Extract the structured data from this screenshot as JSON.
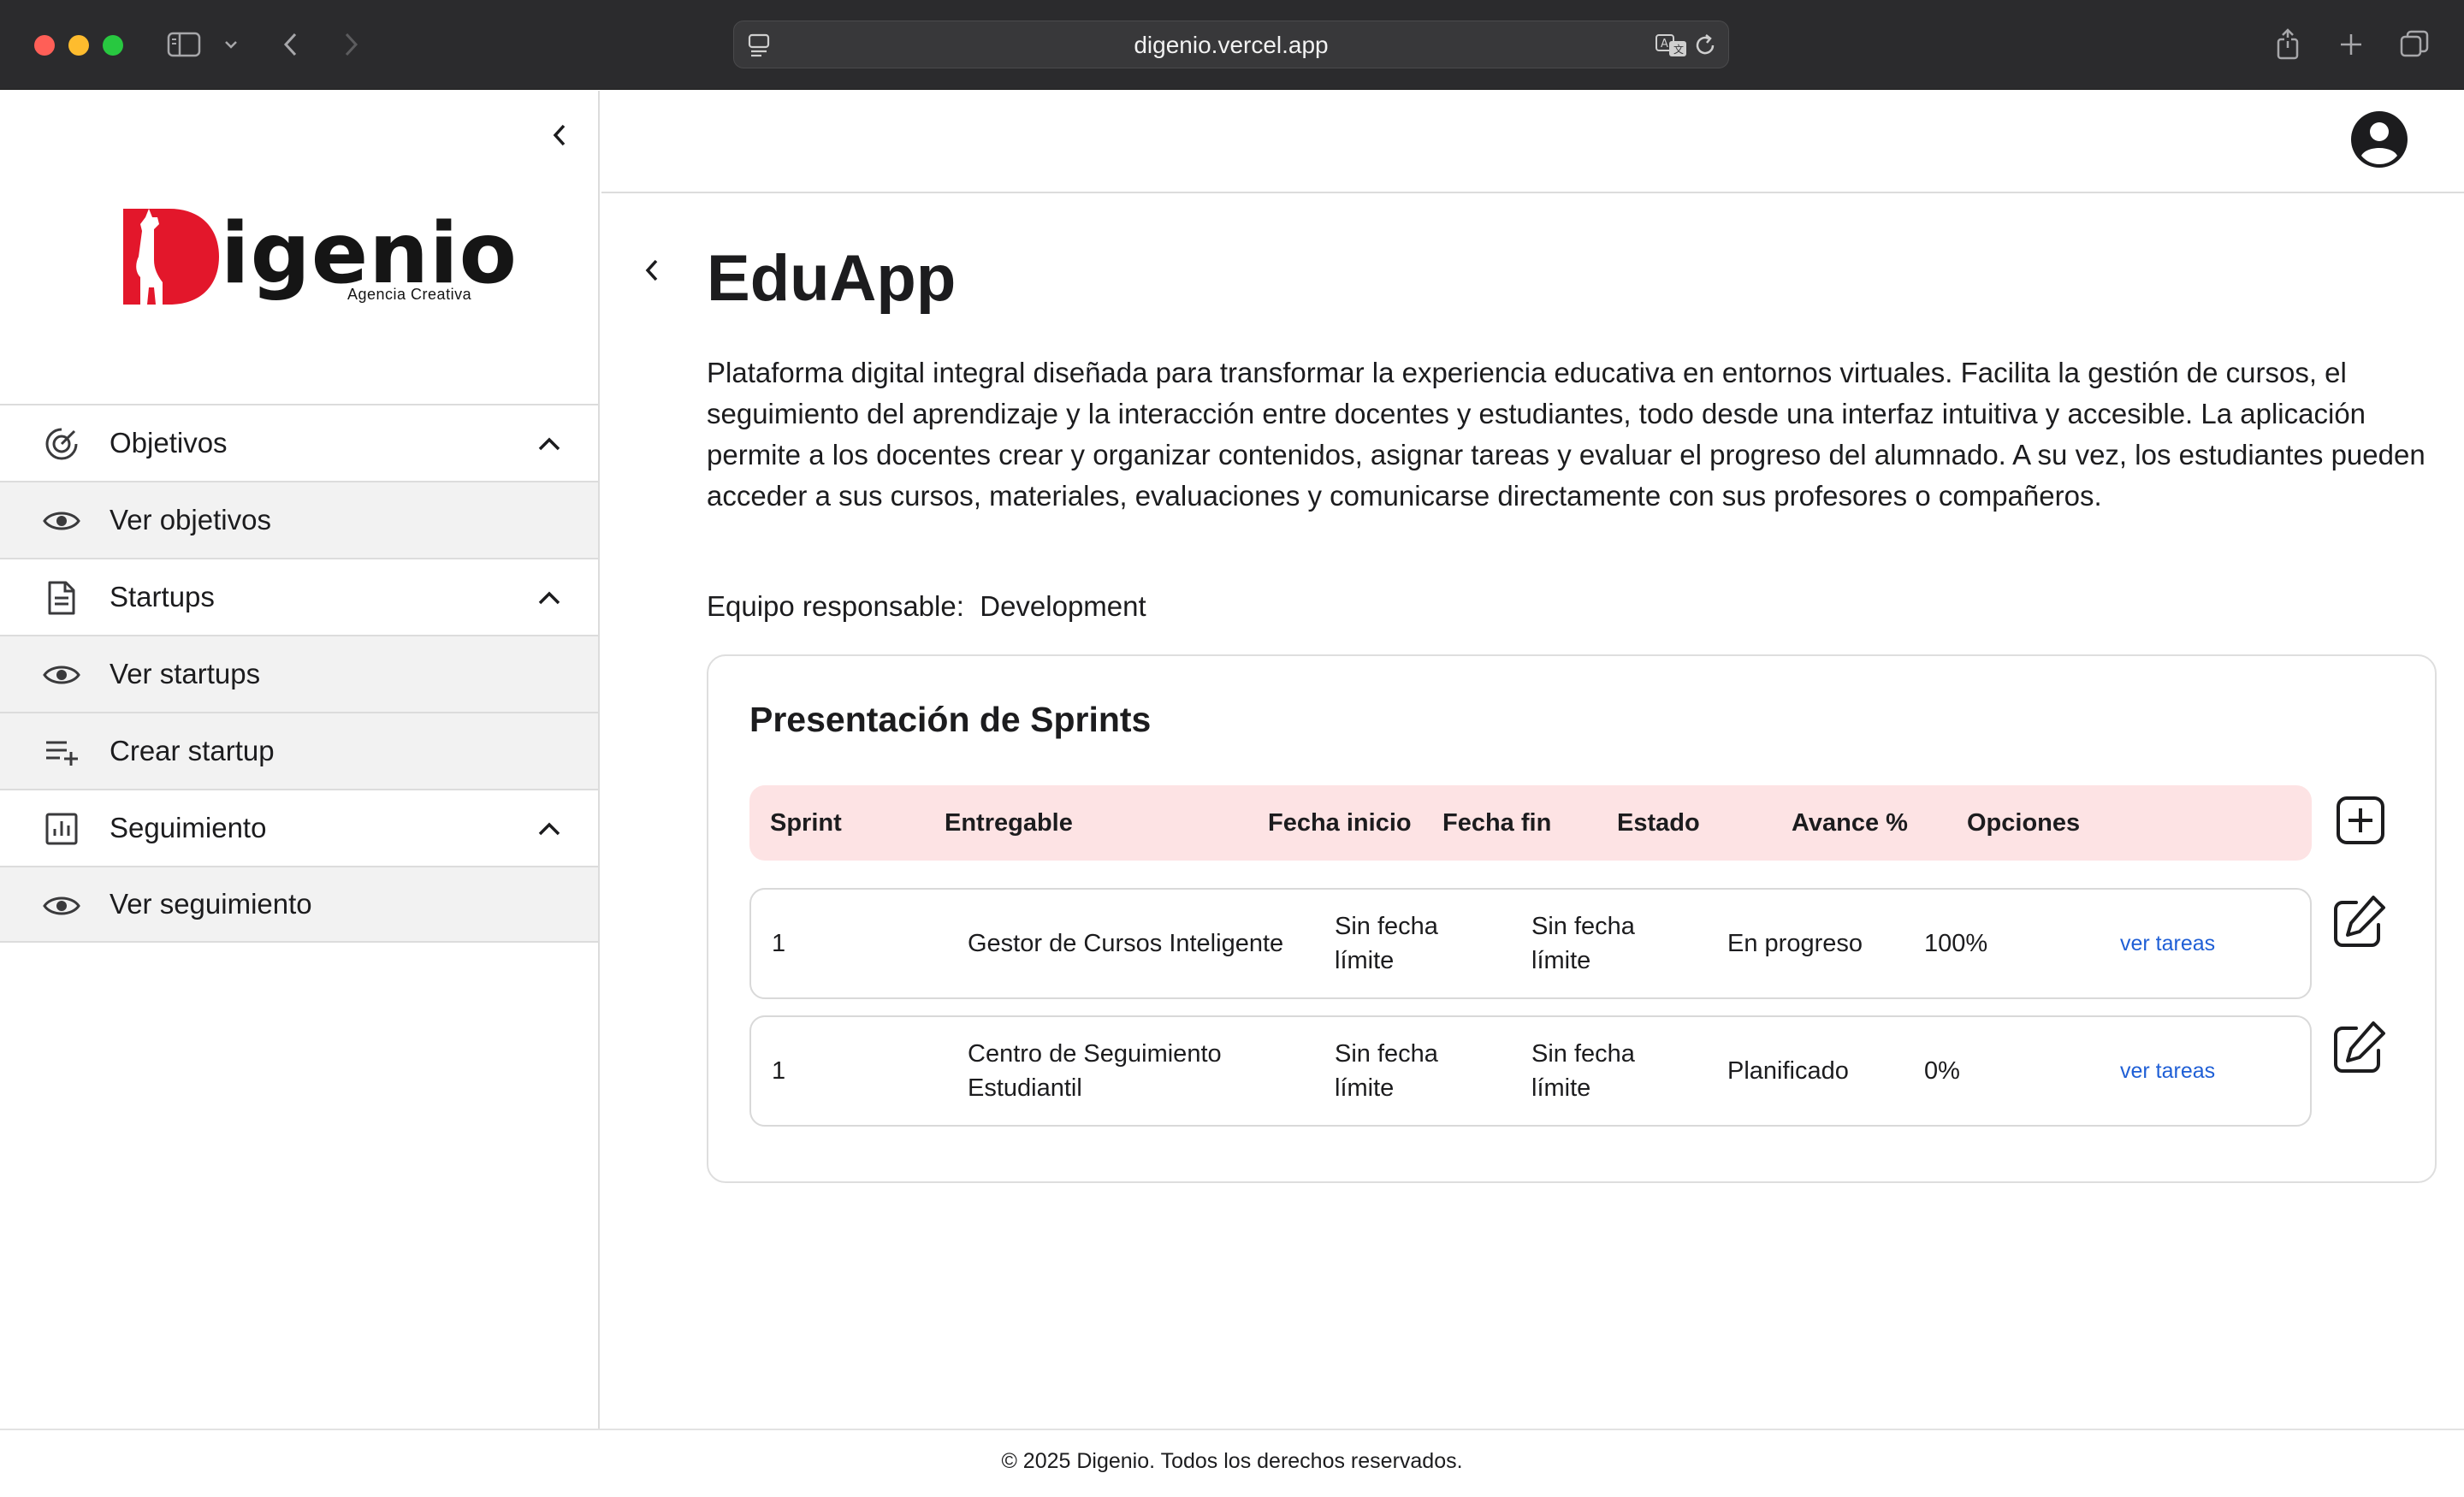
{
  "browser": {
    "url": "digenio.vercel.app"
  },
  "sidebar": {
    "logo": {
      "wordmark": "igenio",
      "initial": "D",
      "tagline": "Agencia Creativa",
      "brand_color": "#e3172b"
    },
    "items": [
      {
        "label": "Objetivos",
        "icon": "target-icon",
        "expanded": true
      },
      {
        "label": "Ver objetivos",
        "icon": "eye-icon"
      },
      {
        "label": "Startups",
        "icon": "document-icon",
        "expanded": true
      },
      {
        "label": "Ver startups",
        "icon": "eye-icon"
      },
      {
        "label": "Crear startup",
        "icon": "playlist-add-icon"
      },
      {
        "label": "Seguimiento",
        "icon": "bar-chart-icon",
        "expanded": true
      },
      {
        "label": "Ver seguimiento",
        "icon": "eye-icon"
      }
    ]
  },
  "page": {
    "title": "EduApp",
    "description": "Plataforma digital integral diseñada para transformar la experiencia educativa en entornos virtuales. Facilita la gestión de cursos, el seguimiento del aprendizaje y la interacción entre docentes y estudiantes, todo desde una interfaz intuitiva y accesible. La aplicación permite a los docentes crear y organizar contenidos, asignar tareas y evaluar el progreso del alumnado. A su vez, los estudiantes pueden acceder a sus cursos, materiales, evaluaciones y comunicarse directamente con sus profesores o compañeros.",
    "team_label": "Equipo responsable:",
    "team_value": "Development"
  },
  "sprints": {
    "title": "Presentación de Sprints",
    "header_color": "#fde3e4",
    "columns": [
      "Sprint",
      "Entregable",
      "Fecha inicio",
      "Fecha fin",
      "Estado",
      "Avance %",
      "Opciones"
    ],
    "rows": [
      {
        "sprint": "1",
        "entregable": "Gestor de Cursos Inteligente",
        "fecha_inicio": "Sin fecha límite",
        "fecha_fin": "Sin fecha límite",
        "estado": "En progreso",
        "avance": "100%",
        "opciones": "ver tareas"
      },
      {
        "sprint": "1",
        "entregable": "Centro de Seguimiento Estudiantil",
        "fecha_inicio": "Sin fecha límite",
        "fecha_fin": "Sin fecha límite",
        "estado": "Planificado",
        "avance": "0%",
        "opciones": "ver tareas"
      }
    ]
  },
  "footer": {
    "text": "© 2025 Digenio. Todos los derechos reservados."
  }
}
